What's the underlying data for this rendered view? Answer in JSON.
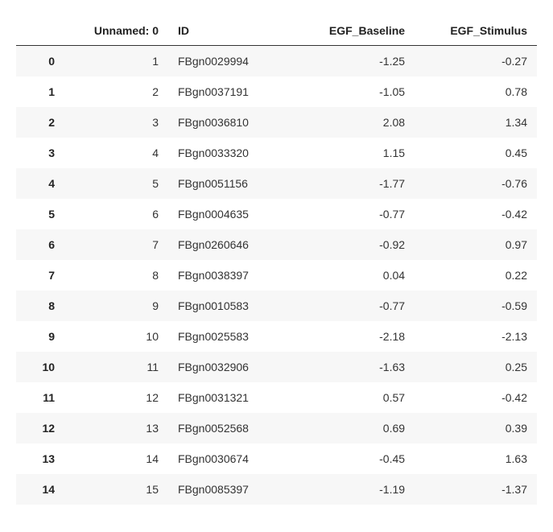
{
  "chart_data": {
    "type": "table",
    "columns": [
      "",
      "Unnamed: 0",
      "ID",
      "EGF_Baseline",
      "EGF_Stimulus"
    ],
    "rows": [
      {
        "index": "0",
        "unnamed": "1",
        "id": "FBgn0029994",
        "baseline": "-1.25",
        "stimulus": "-0.27"
      },
      {
        "index": "1",
        "unnamed": "2",
        "id": "FBgn0037191",
        "baseline": "-1.05",
        "stimulus": "0.78"
      },
      {
        "index": "2",
        "unnamed": "3",
        "id": "FBgn0036810",
        "baseline": "2.08",
        "stimulus": "1.34"
      },
      {
        "index": "3",
        "unnamed": "4",
        "id": "FBgn0033320",
        "baseline": "1.15",
        "stimulus": "0.45"
      },
      {
        "index": "4",
        "unnamed": "5",
        "id": "FBgn0051156",
        "baseline": "-1.77",
        "stimulus": "-0.76"
      },
      {
        "index": "5",
        "unnamed": "6",
        "id": "FBgn0004635",
        "baseline": "-0.77",
        "stimulus": "-0.42"
      },
      {
        "index": "6",
        "unnamed": "7",
        "id": "FBgn0260646",
        "baseline": "-0.92",
        "stimulus": "0.97"
      },
      {
        "index": "7",
        "unnamed": "8",
        "id": "FBgn0038397",
        "baseline": "0.04",
        "stimulus": "0.22"
      },
      {
        "index": "8",
        "unnamed": "9",
        "id": "FBgn0010583",
        "baseline": "-0.77",
        "stimulus": "-0.59"
      },
      {
        "index": "9",
        "unnamed": "10",
        "id": "FBgn0025583",
        "baseline": "-2.18",
        "stimulus": "-2.13"
      },
      {
        "index": "10",
        "unnamed": "11",
        "id": "FBgn0032906",
        "baseline": "-1.63",
        "stimulus": "0.25"
      },
      {
        "index": "11",
        "unnamed": "12",
        "id": "FBgn0031321",
        "baseline": "0.57",
        "stimulus": "-0.42"
      },
      {
        "index": "12",
        "unnamed": "13",
        "id": "FBgn0052568",
        "baseline": "0.69",
        "stimulus": "0.39"
      },
      {
        "index": "13",
        "unnamed": "14",
        "id": "FBgn0030674",
        "baseline": "-0.45",
        "stimulus": "1.63"
      },
      {
        "index": "14",
        "unnamed": "15",
        "id": "FBgn0085397",
        "baseline": "-1.19",
        "stimulus": "-1.37"
      }
    ]
  }
}
